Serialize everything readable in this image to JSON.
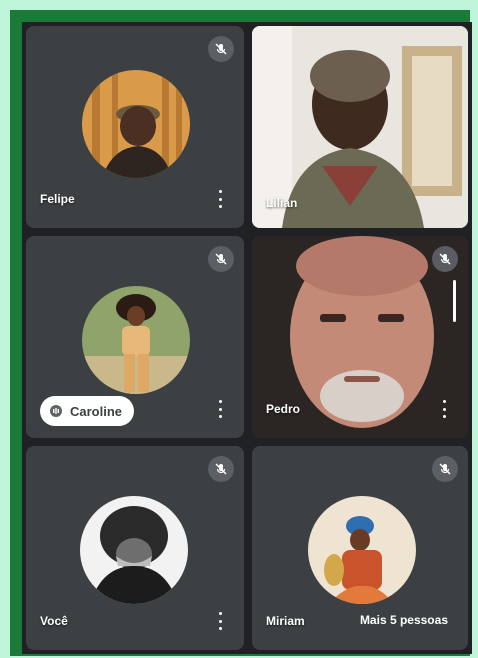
{
  "participants": [
    {
      "name": "Felipe",
      "muted": true
    },
    {
      "name": "Lilian",
      "muted": false
    },
    {
      "name": "Caroline",
      "muted": true,
      "speaking": true
    },
    {
      "name": "Pedro",
      "muted": true
    },
    {
      "name": "Você",
      "muted": true
    },
    {
      "name": "Miriam",
      "muted": true
    }
  ],
  "more_people_label": "Mais 5 pessoas",
  "icons": {
    "mic_off": "mic-off-icon",
    "more": "more-vert-icon",
    "speaking": "audio-wave-icon"
  },
  "colors": {
    "tile_bg": "#3c4043",
    "grid_bg": "#202124",
    "active_border": "#8ab4f8",
    "frame_green": "#1b7a3a",
    "page_bg": "#bff5d8"
  }
}
